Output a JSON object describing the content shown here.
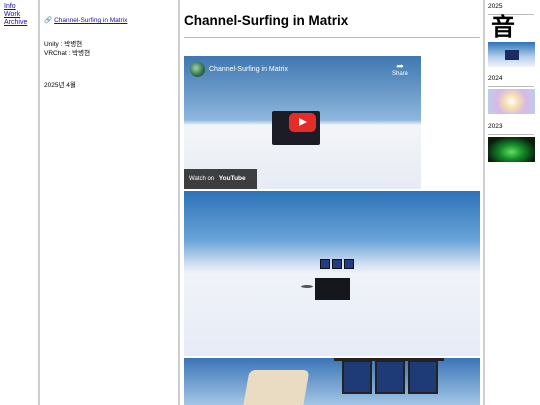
{
  "nav": {
    "items": [
      "Info",
      "Work",
      "Archive"
    ]
  },
  "project": {
    "link_icon": "link-icon",
    "link_text": "Channel-Surfing in Matrix",
    "credits": [
      "Unity : 박병현",
      "VRChat : 박병현"
    ],
    "date": "2025년 4월"
  },
  "main": {
    "title": "Channel-Surfing in Matrix",
    "video": {
      "title": "Channel-Surfing in Matrix",
      "share_label": "Share",
      "watch_on_label": "Watch on",
      "youtube_label": "YouTube",
      "play_color": "#e52d27"
    }
  },
  "side": {
    "years": [
      "2025",
      "2024",
      "2023"
    ],
    "thumb_glyph": "音"
  },
  "colors": {
    "link": "#1a0dab",
    "divider": "#cfcfcf"
  }
}
